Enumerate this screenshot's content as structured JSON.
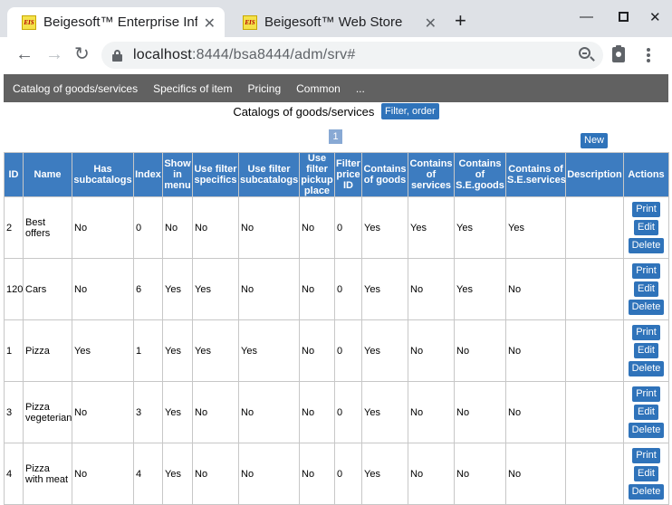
{
  "browser": {
    "tabs": [
      {
        "label": "Beigesoft™ Enterprise Info",
        "favicon": "EIS"
      },
      {
        "label": "Beigesoft™ Web Store",
        "favicon": "EIS"
      }
    ],
    "url": {
      "host": "localhost",
      "rest": ":8444/bsa8444/adm/srv#"
    }
  },
  "nav": {
    "items": [
      "Catalog of goods/services",
      "Specifics of item",
      "Pricing",
      "Common",
      "..."
    ]
  },
  "page": {
    "title": "Catalogs of goods/services",
    "filter_label": "Filter, order",
    "page_number": "1",
    "new_label": "New"
  },
  "table": {
    "columns": [
      "ID",
      "Name",
      "Has subcatalogs",
      "Index",
      "Show in menu",
      "Use filter specifics",
      "Use filter subcatalogs",
      "Use filter pickup place",
      "Filter price ID",
      "Contains of goods",
      "Contains of services",
      "Contains of S.E.goods",
      "Contains of S.E.services",
      "Description",
      "Actions"
    ],
    "action_labels": {
      "print": "Print",
      "edit": "Edit",
      "delete": "Delete"
    },
    "rows": [
      [
        "2",
        "Best offers",
        "No",
        "0",
        "No",
        "No",
        "No",
        "No",
        "0",
        "Yes",
        "Yes",
        "Yes",
        "Yes",
        ""
      ],
      [
        "120",
        "Cars",
        "No",
        "6",
        "Yes",
        "Yes",
        "No",
        "No",
        "0",
        "Yes",
        "No",
        "Yes",
        "No",
        ""
      ],
      [
        "1",
        "Pizza",
        "Yes",
        "1",
        "Yes",
        "Yes",
        "Yes",
        "No",
        "0",
        "Yes",
        "No",
        "No",
        "No",
        ""
      ],
      [
        "3",
        "Pizza vegeterian",
        "No",
        "3",
        "Yes",
        "No",
        "No",
        "No",
        "0",
        "Yes",
        "No",
        "No",
        "No",
        ""
      ],
      [
        "4",
        "Pizza with meat",
        "No",
        "4",
        "Yes",
        "No",
        "No",
        "No",
        "0",
        "Yes",
        "No",
        "No",
        "No",
        ""
      ]
    ]
  },
  "colors": {
    "nav_background": "#616161",
    "header_background": "#3d7cc0",
    "button": "#2f73ba",
    "pager": "#88a9d4"
  }
}
